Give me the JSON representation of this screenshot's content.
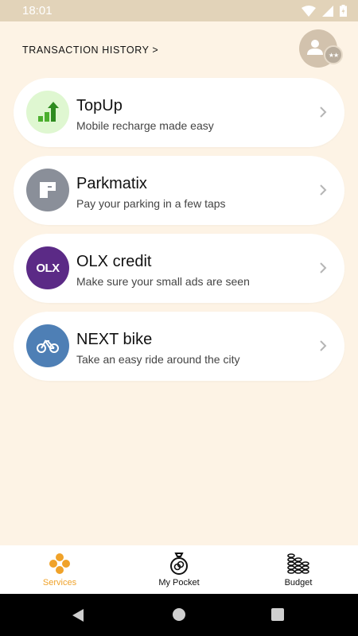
{
  "status_bar": {
    "time": "18:01"
  },
  "header": {
    "transaction_history_link": "TRANSACTION HISTORY >"
  },
  "services": [
    {
      "title": "TopUp",
      "subtitle": "Mobile recharge made easy",
      "icon": "topup-icon",
      "icon_bg": "#dff7d1"
    },
    {
      "title": "Parkmatix",
      "subtitle": "Pay your parking in a few taps",
      "icon": "parkmatix-icon",
      "icon_bg": "#8a8f99"
    },
    {
      "title": "OLX credit",
      "subtitle": "Make sure your small ads are seen",
      "icon": "olx-icon",
      "icon_bg": "#5b2a86",
      "icon_text": "OLX"
    },
    {
      "title": "NEXT bike",
      "subtitle": "Take an easy ride around the city",
      "icon": "bike-icon",
      "icon_bg": "#4e7fb5"
    }
  ],
  "bottom_nav": [
    {
      "label": "Services",
      "icon": "services-icon",
      "active": true
    },
    {
      "label": "My Pocket",
      "icon": "pocket-icon",
      "active": false
    },
    {
      "label": "Budget",
      "icon": "budget-icon",
      "active": false
    }
  ],
  "colors": {
    "background": "#fdf3e5",
    "accent": "#f0a229",
    "status_bar": "#e2d3b9"
  }
}
